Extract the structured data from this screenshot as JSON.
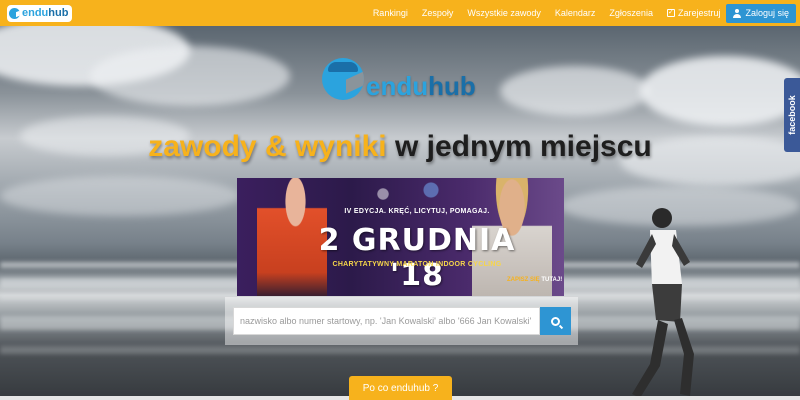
{
  "brand": {
    "name_a": "endu",
    "name_b": "hub"
  },
  "nav": {
    "links": [
      "Rankingi",
      "Zespoły",
      "Wszystkie zawody",
      "Kalendarz",
      "Zgłoszenia"
    ],
    "register": "Zarejestruj",
    "login": "Zaloguj się"
  },
  "hero": {
    "tagline_highlight": "zawody & wyniki",
    "tagline_rest": " w jednym miejscu"
  },
  "banner": {
    "top_text": "IV EDYCJA. KRĘĆ, LICYTUJ, POMAGAJ.",
    "date": "2 GRUDNIA '18",
    "subtitle": "CHARYTATYWNY MARATON INDOOR CYCLING",
    "cta_prefix": "ZAPISZ SIĘ ",
    "cta_link": "TUTAJ!"
  },
  "search": {
    "placeholder": "nazwisko albo numer startowy, np. 'Jan Kowalski' albo '666 Jan Kowalski'"
  },
  "about_button": "Po co enduhub ?",
  "facebook_tab": "facebook",
  "colors": {
    "accent": "#f7b21c",
    "primary": "#2e95d3",
    "brand_blue": "#2ba3de",
    "facebook": "#3b5998"
  },
  "icons": [
    "logo-icon",
    "register-icon",
    "user-icon",
    "search-icon"
  ]
}
